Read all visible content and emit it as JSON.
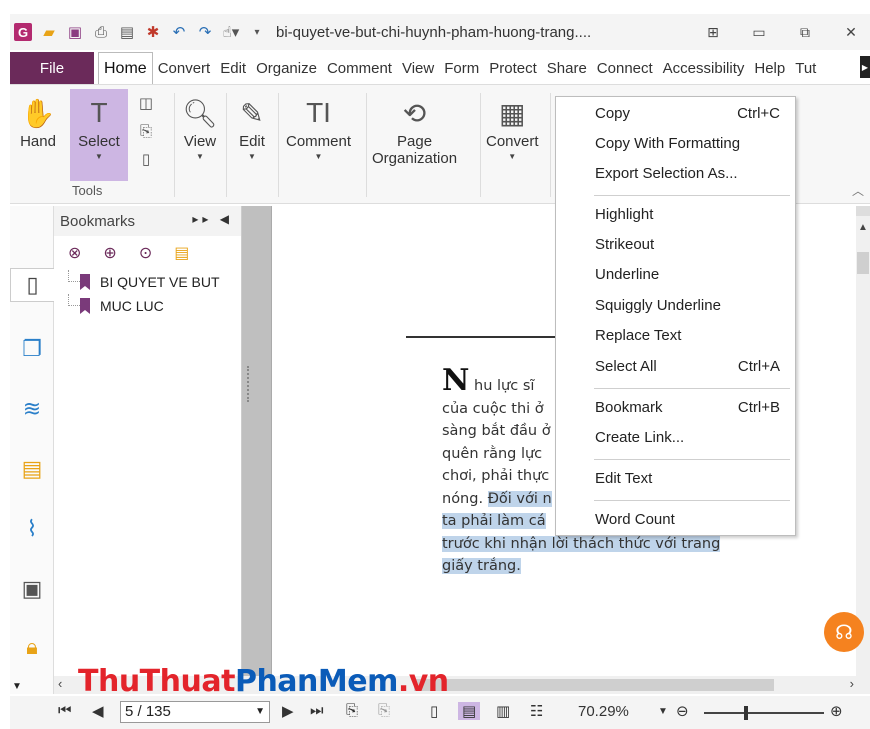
{
  "titlebar": {
    "title": "bi-quyet-ve-but-chi-huynh-pham-huong-trang....",
    "quick_access": [
      "app-logo-icon",
      "folder-open-icon",
      "save-icon",
      "print-icon",
      "scan-icon",
      "new-icon",
      "undo-icon",
      "redo-icon",
      "hand-dropdown-icon"
    ]
  },
  "menubar": {
    "file": "File",
    "tabs": [
      "Home",
      "Convert",
      "Edit",
      "Organize",
      "Comment",
      "View",
      "Form",
      "Protect",
      "Share",
      "Connect",
      "Accessibility",
      "Help",
      "Tut"
    ]
  },
  "ribbon": {
    "hand": "Hand",
    "select": "Select",
    "tools_group": "Tools",
    "view": "View",
    "edit": "Edit",
    "comment": "Comment",
    "page_org_1": "Page",
    "page_org_2": "Organization",
    "convert": "Convert"
  },
  "bookmarks": {
    "title": "Bookmarks",
    "items": [
      "BI QUYET VE BUT",
      "MUC LUC"
    ]
  },
  "document": {
    "drop_cap": "N",
    "line1": "hu lực sĩ",
    "line2": "của cuộc thi ở",
    "line3": "sàng bắt đầu ở",
    "line4": "quên rằng lực",
    "line5": "chơi, phải thực",
    "line6_plain": "nóng. ",
    "line6_hl": "Đối với n",
    "line7_hl": "ta phải làm cá",
    "line8_hl": "trước khi nhận lời thách thức với trang",
    "line9_hl": "giấy trắng."
  },
  "context_menu": {
    "copy": "Copy",
    "copy_sc": "Ctrl+C",
    "copy_fmt": "Copy With Formatting",
    "export": "Export Selection As...",
    "highlight": "Highlight",
    "strikeout": "Strikeout",
    "underline": "Underline",
    "squiggly": "Squiggly Underline",
    "replace": "Replace Text",
    "select_all": "Select All",
    "select_all_sc": "Ctrl+A",
    "bookmark": "Bookmark",
    "bookmark_sc": "Ctrl+B",
    "create_link": "Create Link...",
    "edit_text": "Edit Text",
    "word_count": "Word Count"
  },
  "statusbar": {
    "page": "5 / 135",
    "zoom": "70.29%"
  },
  "watermark": {
    "part1": "ThuThuat",
    "part2": "PhanMem",
    "part3": ".vn"
  },
  "colors": {
    "file_tab": "#6b2a5a",
    "select_highlight": "#cdb6e3",
    "text_highlight": "#bfd4ea",
    "help_orange": "#f5821f"
  }
}
